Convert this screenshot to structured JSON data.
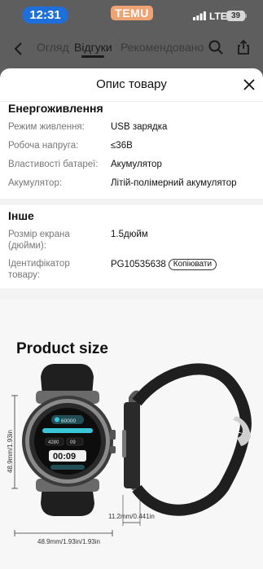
{
  "status_bar": {
    "time": "12:31",
    "app_badge": "TEMU",
    "network": "LTE",
    "battery": "39"
  },
  "nav": {
    "tabs": [
      "Огляд",
      "Відгуки",
      "Рекомендовано"
    ],
    "active_tab": "Відгуки"
  },
  "sheet": {
    "title": "Опис товару",
    "sections": [
      {
        "title": "Енергоживлення",
        "rows": [
          {
            "label": "Режим живлення:",
            "value": "USB зарядка"
          },
          {
            "label": "Робоча напруга:",
            "value": "≤36В"
          },
          {
            "label": "Властивості батареї:",
            "value": "Акумулятор"
          },
          {
            "label": "Акумулятор:",
            "value": "Літій-полімерний акумулятор"
          }
        ]
      },
      {
        "title": "Інше",
        "rows": [
          {
            "label": "Розмір екрана (дюйми):",
            "value": "1.5дюйм"
          },
          {
            "label": "Ідентифікатор товару:",
            "value": "PG10535638",
            "action": "Копіювати"
          }
        ]
      }
    ]
  },
  "product_image": {
    "title": "Product size",
    "height_label": "48.9mm/1.93in",
    "width_label": "48.9mm/1.93in/1.93in",
    "thickness_label": "11.2mm/0.441in",
    "watch_face": {
      "steps": "60000",
      "heart": "4280",
      "time": "00:09",
      "readout": "09"
    }
  }
}
